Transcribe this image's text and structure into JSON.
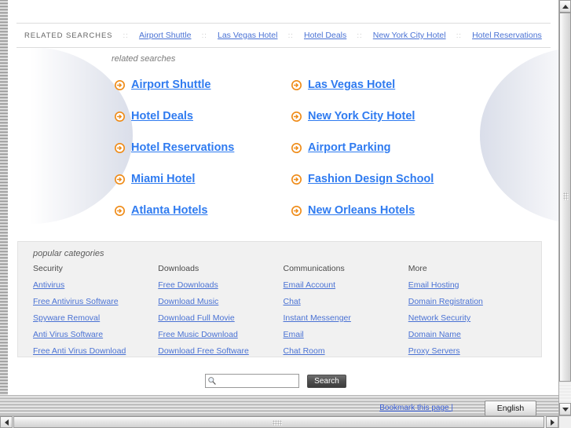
{
  "topbar": {
    "label": "RELATED SEARCHES",
    "separator": "::",
    "links": [
      "Airport Shuttle",
      "Las Vegas Hotel",
      "Hotel Deals",
      "New York City Hotel",
      "Hotel Reservations"
    ]
  },
  "related": {
    "heading": "related searches",
    "icon": "arrow-circle-right-icon",
    "links": [
      "Airport Shuttle",
      "Las Vegas Hotel",
      "Hotel Deals",
      "New York City Hotel",
      "Hotel Reservations",
      "Airport Parking",
      "Miami Hotel",
      "Fashion Design School",
      "Atlanta Hotels",
      "New Orleans Hotels"
    ]
  },
  "categories": {
    "title": "popular categories",
    "columns": [
      {
        "head": "Security",
        "links": [
          "Antivirus",
          "Free Antivirus Software",
          "Spyware Removal",
          "Anti Virus Software",
          "Free Anti Virus Download"
        ]
      },
      {
        "head": "Downloads",
        "links": [
          "Free Downloads",
          "Download Music",
          "Download Full Movie",
          "Free Music Download",
          "Download Free Software"
        ]
      },
      {
        "head": "Communications",
        "links": [
          "Email Account",
          "Chat",
          "Instant Messenger",
          "Email",
          "Chat Room"
        ]
      },
      {
        "head": "More",
        "links": [
          "Email Hosting",
          "Domain Registration",
          "Network Security",
          "Domain Name",
          "Proxy Servers"
        ]
      }
    ]
  },
  "search": {
    "icon": "search-icon",
    "value": "",
    "placeholder": "",
    "button_label": "Search"
  },
  "footer": {
    "bookmark_label": "Bookmark this page |",
    "language": "English"
  },
  "colors": {
    "link_blue": "#2f7bf0",
    "small_link_blue": "#4a72d4",
    "arrow_orange": "#f28c1e",
    "panel_gray": "#f1f1f1"
  }
}
